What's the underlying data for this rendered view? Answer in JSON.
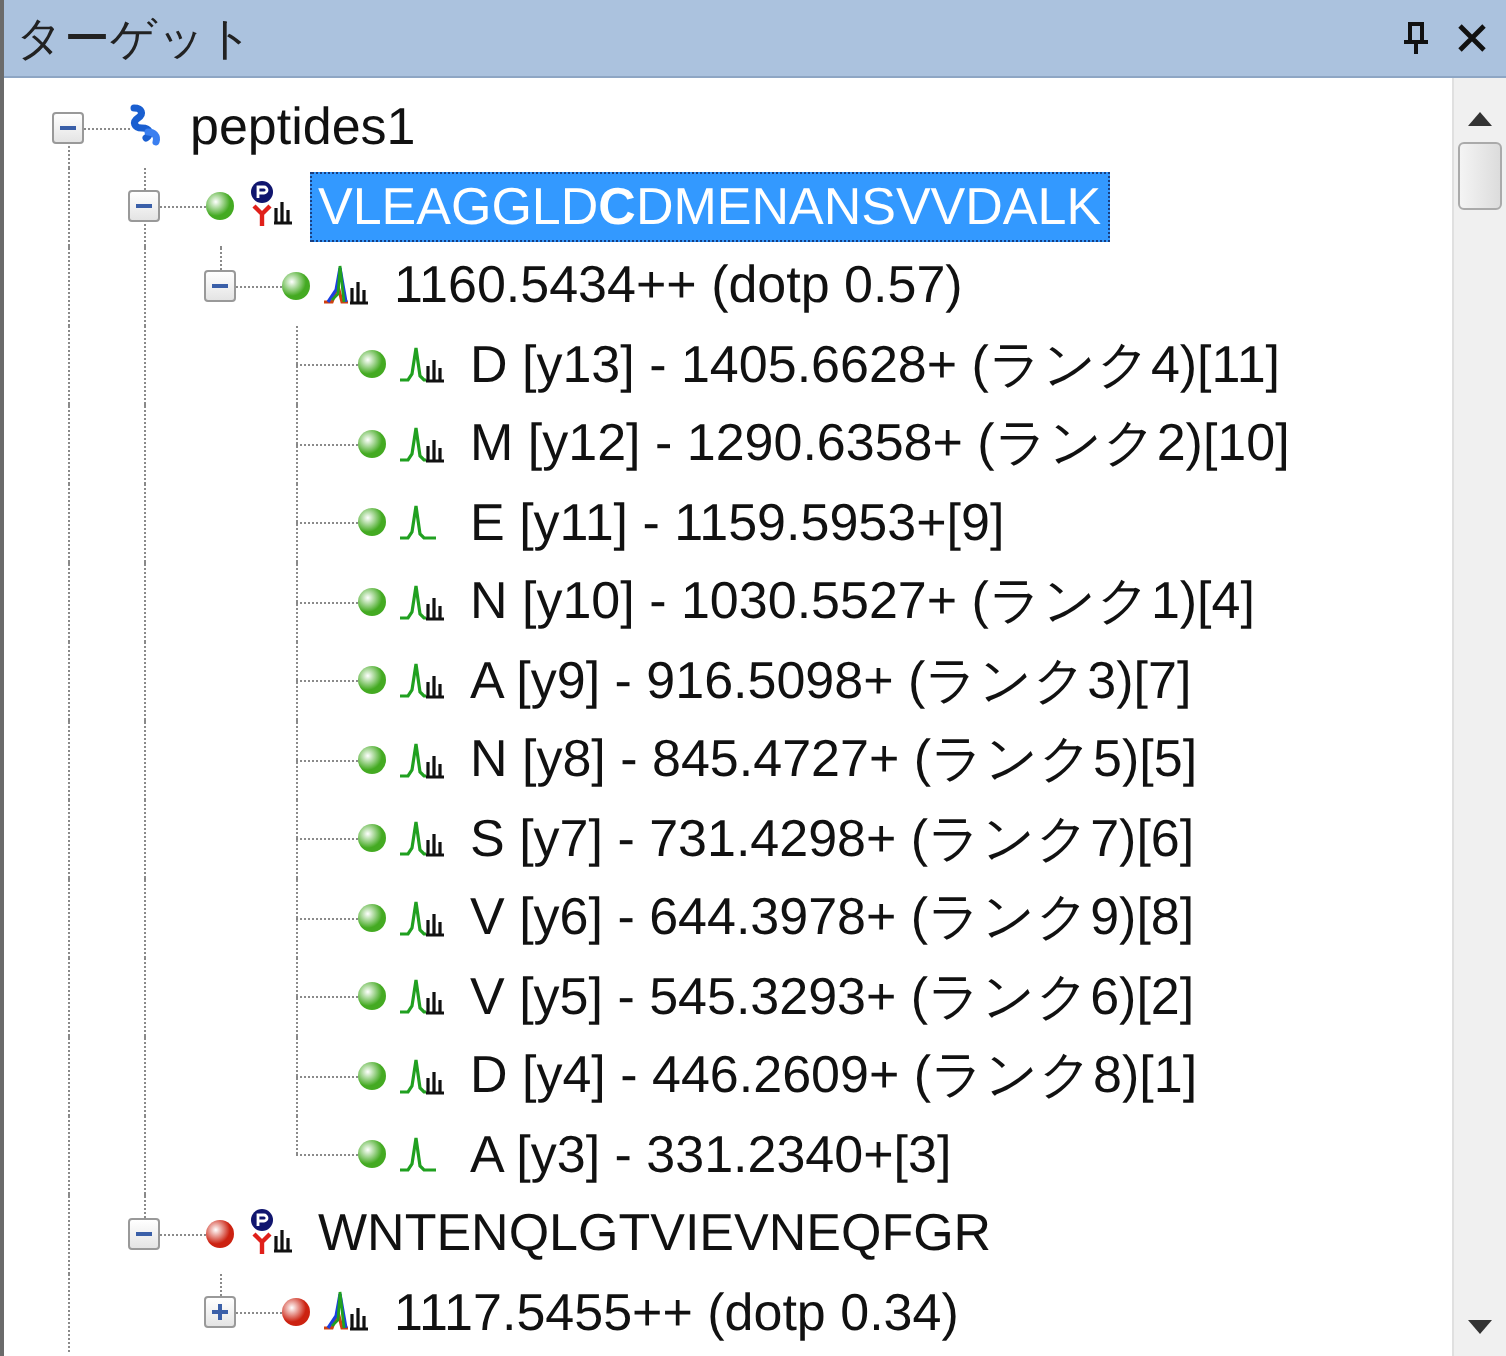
{
  "panel": {
    "title": "ターゲット"
  },
  "tree": [
    {
      "kind": "group",
      "label": "peptides1",
      "expanded": true,
      "selected": false,
      "children": [
        {
          "kind": "peptide",
          "label": "VLEAGGLD**C**DMENANSVVDALK",
          "color": "#44aa22",
          "expanded": true,
          "selected": true,
          "children": [
            {
              "kind": "precursor",
              "label": "1160.5434++ (dotp 0.57)",
              "color": "#44aa22",
              "expanded": true,
              "selected": false,
              "children": [
                {
                  "kind": "transition",
                  "label": "D [y13] - 1405.6628+ (ランク4)[11]",
                  "color": "#44aa22",
                  "library_match": true,
                  "selected": false
                },
                {
                  "kind": "transition",
                  "label": "M [y12] - 1290.6358+ (ランク2)[10]",
                  "color": "#44aa22",
                  "library_match": true,
                  "selected": false
                },
                {
                  "kind": "transition",
                  "label": "E [y11] - 1159.5953+[9]",
                  "color": "#44aa22",
                  "library_match": false,
                  "selected": false
                },
                {
                  "kind": "transition",
                  "label": "N [y10] - 1030.5527+ (ランク1)[4]",
                  "color": "#44aa22",
                  "library_match": true,
                  "selected": false
                },
                {
                  "kind": "transition",
                  "label": "A [y9] - 916.5098+ (ランク3)[7]",
                  "color": "#44aa22",
                  "library_match": true,
                  "selected": false
                },
                {
                  "kind": "transition",
                  "label": "N [y8] - 845.4727+ (ランク5)[5]",
                  "color": "#44aa22",
                  "library_match": true,
                  "selected": false
                },
                {
                  "kind": "transition",
                  "label": "S [y7] - 731.4298+ (ランク7)[6]",
                  "color": "#44aa22",
                  "library_match": true,
                  "selected": false
                },
                {
                  "kind": "transition",
                  "label": "V [y6] - 644.3978+ (ランク9)[8]",
                  "color": "#44aa22",
                  "library_match": true,
                  "selected": false
                },
                {
                  "kind": "transition",
                  "label": "V [y5] - 545.3293+ (ランク6)[2]",
                  "color": "#44aa22",
                  "library_match": true,
                  "selected": false
                },
                {
                  "kind": "transition",
                  "label": "D [y4] - 446.2609+ (ランク8)[1]",
                  "color": "#44aa22",
                  "library_match": true,
                  "selected": false
                },
                {
                  "kind": "transition",
                  "label": "A [y3] - 331.2340+[3]",
                  "color": "#44aa22",
                  "library_match": false,
                  "selected": false
                }
              ]
            }
          ]
        },
        {
          "kind": "peptide",
          "label": "WNTENQLGTVIEVNEQFGR",
          "color": "#cc2211",
          "expanded": true,
          "selected": false,
          "children": [
            {
              "kind": "precursor",
              "label": "1117.5455++ (dotp 0.34)",
              "color": "#cc2211",
              "expanded": false,
              "selected": false
            }
          ]
        }
      ]
    }
  ]
}
